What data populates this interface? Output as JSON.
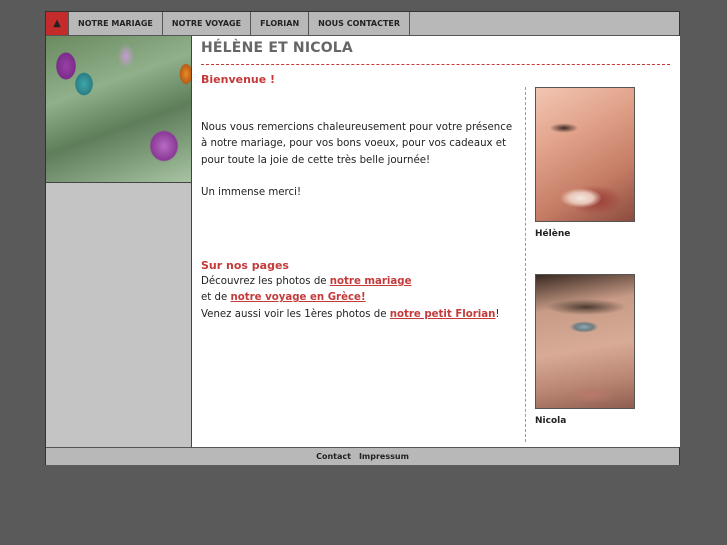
{
  "nav": {
    "home_icon": "home-icon",
    "items": [
      "NOTRE MARIAGE",
      "NOTRE VOYAGE",
      "FLORIAN",
      "NOUS CONTACTER"
    ]
  },
  "main": {
    "title": "HÉLÈNE ET NICOLA",
    "welcome_heading": "Bienvenue !",
    "intro_text": "Nous vous remercions chaleureusement pour votre présence à notre mariage, pour vos bons voeux, pour vos cadeaux et pour toute la joie de cette très belle journée!",
    "thanks_text": "Un immense merci!",
    "pages_heading": "Sur nos pages",
    "line1_prefix": "Découvrez les photos de ",
    "line1_link": "notre mariage",
    "line2_prefix": "et de ",
    "line2_link": "notre voyage en Grèce!",
    "line3_prefix": "Venez aussi voir les 1ères photos de ",
    "line3_link": "notre petit Florian",
    "line3_suffix": "!"
  },
  "photos": {
    "helene_caption": "Hélène",
    "nicola_caption": "Nicola"
  },
  "footer": {
    "contact": "Contact",
    "impressum": "Impressum"
  },
  "colors": {
    "accent_red": "#c43a3a",
    "nav_gray": "#b8b8b8",
    "background": "#5a5a5a"
  }
}
